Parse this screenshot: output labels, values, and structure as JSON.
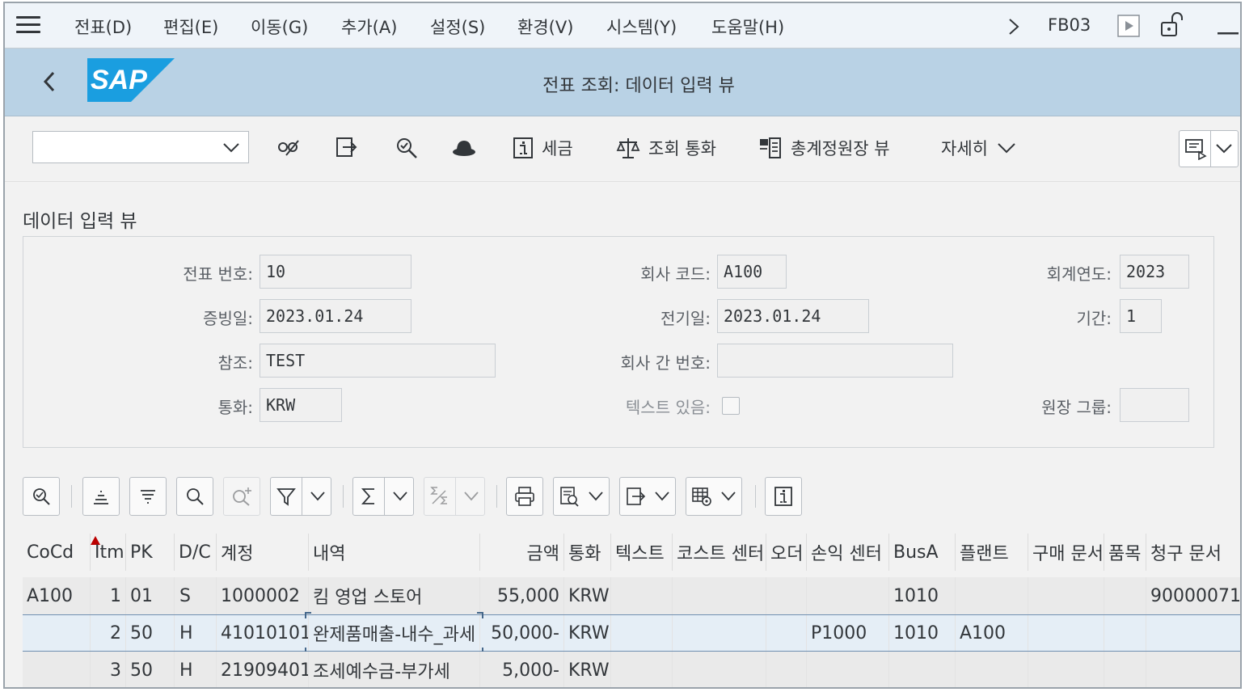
{
  "menu": {
    "items": [
      "전표(D)",
      "편집(E)",
      "이동(G)",
      "추가(A)",
      "설정(S)",
      "환경(V)",
      "시스템(Y)",
      "도움말(H)"
    ],
    "tcode": "FB03"
  },
  "shell": {
    "logo_text": "SAP",
    "title": "전표 조회: 데이터 입력 뷰"
  },
  "toolbar": {
    "select_value": "",
    "tax_label": "세금",
    "display_currency_label": "조회 통화",
    "gl_view_label": "총계정원장 뷰",
    "more_label": "자세히"
  },
  "form": {
    "section_title": "데이터 입력 뷰",
    "doc_no_label": "전표 번호:",
    "doc_no": "10",
    "company_code_label": "회사 코드:",
    "company_code": "A100",
    "fiscal_year_label": "회계연도:",
    "fiscal_year": "2023",
    "doc_date_label": "증빙일:",
    "doc_date": "2023.01.24",
    "posting_date_label": "전기일:",
    "posting_date": "2023.01.24",
    "period_label": "기간:",
    "period": "1",
    "reference_label": "참조:",
    "reference": "TEST",
    "intercompany_label": "회사 간 번호:",
    "intercompany": "",
    "currency_label": "통화:",
    "currency": "KRW",
    "text_exists_label": "텍스트 있음:",
    "ledger_group_label": "원장 그룹:",
    "ledger_group": ""
  },
  "grid": {
    "columns": [
      "CoCd",
      "Itm",
      "PK",
      "D/C",
      "계정",
      "내역",
      "금액",
      "통화",
      "텍스트",
      "코스트 센터",
      "오더",
      "손익 센터",
      "BusA",
      "플랜트",
      "구매 문서",
      "품목",
      "청구 문서"
    ],
    "rows": [
      [
        "A100",
        "1",
        "01",
        "S",
        "1000002",
        "킴 영업 스토어",
        "55,000",
        "KRW",
        "",
        "",
        "",
        "",
        "1010",
        "",
        "",
        "",
        "90000071"
      ],
      [
        "",
        "2",
        "50",
        "H",
        "41010101",
        "완제품매출-내수_과세",
        "50,000-",
        "KRW",
        "",
        "",
        "",
        "P1000",
        "1010",
        "A100",
        "",
        "",
        ""
      ],
      [
        "",
        "3",
        "50",
        "H",
        "21909401",
        "조세예수금-부가세",
        "5,000-",
        "KRW",
        "",
        "",
        "",
        "",
        "",
        "",
        "",
        "",
        ""
      ]
    ]
  },
  "colors": {
    "shell_bg": "#b9d2e5",
    "sap_blue": "#1a9ee0",
    "selected_row": "#e5eef6",
    "sort_marker": "#bb0000"
  },
  "icons": [
    "menu-icon",
    "nav-forward-icon",
    "execute-icon",
    "unlock-icon",
    "minimize-icon",
    "back-icon",
    "edit-glasses-icon",
    "switch-icon",
    "display-icon",
    "hat-icon",
    "info-icon",
    "scale-icon",
    "ledger-icon",
    "chevron-down-icon",
    "message-icon",
    "sort-asc-icon",
    "sort-desc-icon",
    "find-icon",
    "find-next-icon",
    "filter-icon",
    "sum-icon",
    "subtotal-icon",
    "print-icon",
    "layout-icon",
    "export-icon",
    "grid-settings-icon"
  ]
}
